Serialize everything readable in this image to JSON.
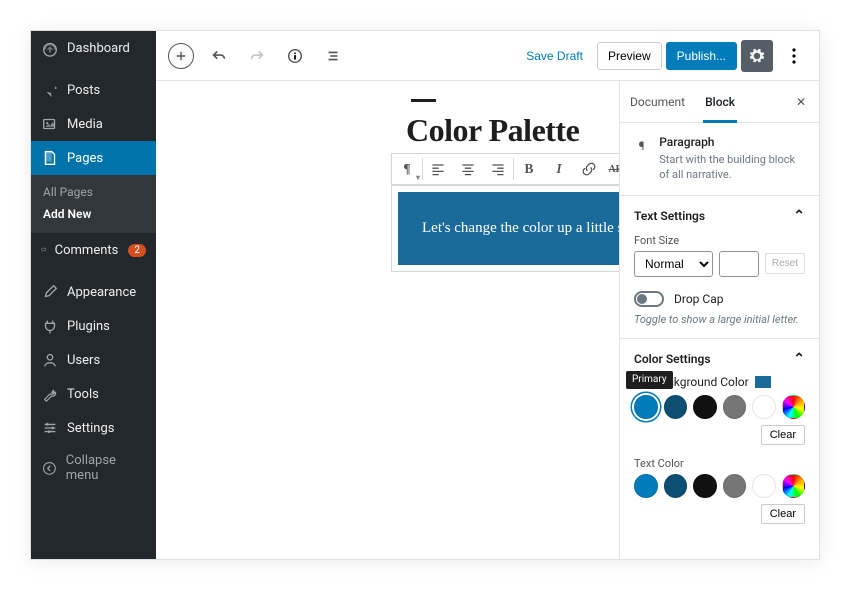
{
  "sidebar": {
    "items": [
      {
        "icon": "dashboard",
        "label": "Dashboard"
      },
      {
        "icon": "pin",
        "label": "Posts"
      },
      {
        "icon": "media",
        "label": "Media"
      },
      {
        "icon": "page",
        "label": "Pages",
        "active": true
      },
      {
        "icon": "comment",
        "label": "Comments",
        "badge": "2"
      },
      {
        "icon": "brush",
        "label": "Appearance"
      },
      {
        "icon": "plug",
        "label": "Plugins"
      },
      {
        "icon": "user",
        "label": "Users"
      },
      {
        "icon": "wrench",
        "label": "Tools"
      },
      {
        "icon": "sliders",
        "label": "Settings"
      },
      {
        "icon": "collapse",
        "label": "Collapse menu"
      }
    ],
    "sub": {
      "all": "All Pages",
      "add": "Add New"
    }
  },
  "topbar": {
    "save_draft": "Save Draft",
    "preview": "Preview",
    "publish": "Publish..."
  },
  "editor": {
    "title": "Color Palette",
    "paragraph": "Let's change the color up a little shall we?"
  },
  "panel": {
    "tabs": {
      "document": "Document",
      "block": "Block"
    },
    "block_type": "Paragraph",
    "block_desc": "Start with the building block of all narrative.",
    "text_settings": {
      "heading": "Text Settings",
      "font_size_label": "Font Size",
      "font_size_value": "Normal",
      "reset": "Reset",
      "drop_cap": "Drop Cap",
      "drop_cap_hint": "Toggle to show a large initial letter."
    },
    "color_settings": {
      "heading": "Color Settings",
      "bg_label": "Background Color",
      "text_label": "Text Color",
      "clear": "Clear",
      "tooltip": "Primary",
      "bg_swatch": "#1a6a9a",
      "colors": [
        "#007cba",
        "#0d4f73",
        "#111111",
        "#767676",
        "#ffffff"
      ]
    }
  }
}
